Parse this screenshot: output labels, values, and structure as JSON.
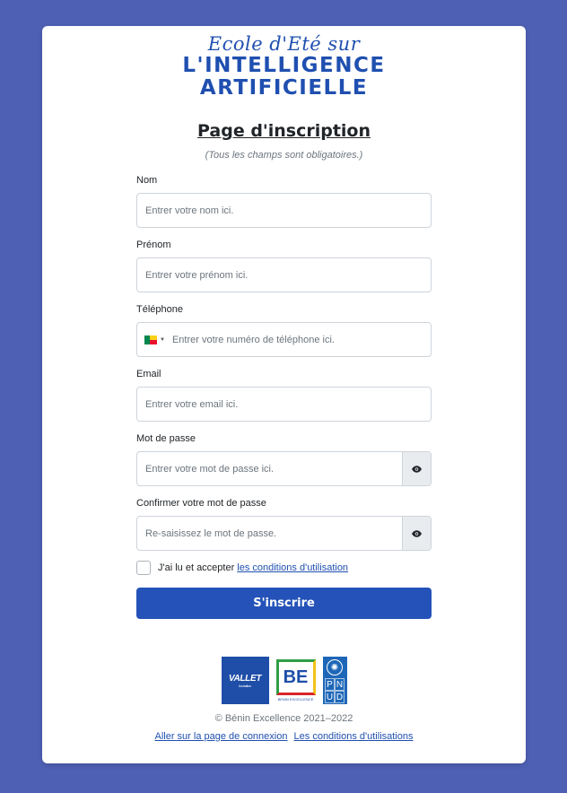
{
  "brand": {
    "line1": "Ecole d'Eté sur",
    "line2": "L'INTELLIGENCE",
    "line3": "ARTIFICIELLE"
  },
  "page": {
    "title": "Page d'inscription",
    "subtitle": "(Tous les champs sont obligatoires.)"
  },
  "form": {
    "nom": {
      "label": "Nom",
      "placeholder": "Entrer votre nom ici."
    },
    "prenom": {
      "label": "Prénom",
      "placeholder": "Entrer votre prénom ici."
    },
    "telephone": {
      "label": "Téléphone",
      "placeholder": "Entrer votre numéro de téléphone ici.",
      "country": "bj-flag-icon"
    },
    "email": {
      "label": "Email",
      "placeholder": "Entrer votre email ici."
    },
    "password": {
      "label": "Mot de passe",
      "placeholder": "Entrer votre mot de passe ici."
    },
    "confirm": {
      "label": "Confirmer votre mot de passe",
      "placeholder": "Re-saisissez le mot de passe."
    },
    "terms": {
      "prefix": "J'ai lu et accepter",
      "link": "les conditions d'utilisation",
      "checked": false
    },
    "submit": "S'inscrire"
  },
  "logos": {
    "vallet": "VALLET",
    "vallet_sub": "fondation",
    "be": "BE",
    "be_sub": "BENIN EXCELLENCE",
    "pnud_letters": [
      "P",
      "N",
      "U",
      "D"
    ]
  },
  "footer": {
    "copyright": "© Bénin Excellence 2021–2022",
    "login_link": "Aller sur la page de connexion",
    "terms_link": "Les conditions d'utilisations"
  },
  "colors": {
    "background": "#4e60b3",
    "primary": "#2452b8",
    "brand_text": "#1f4fb0"
  }
}
